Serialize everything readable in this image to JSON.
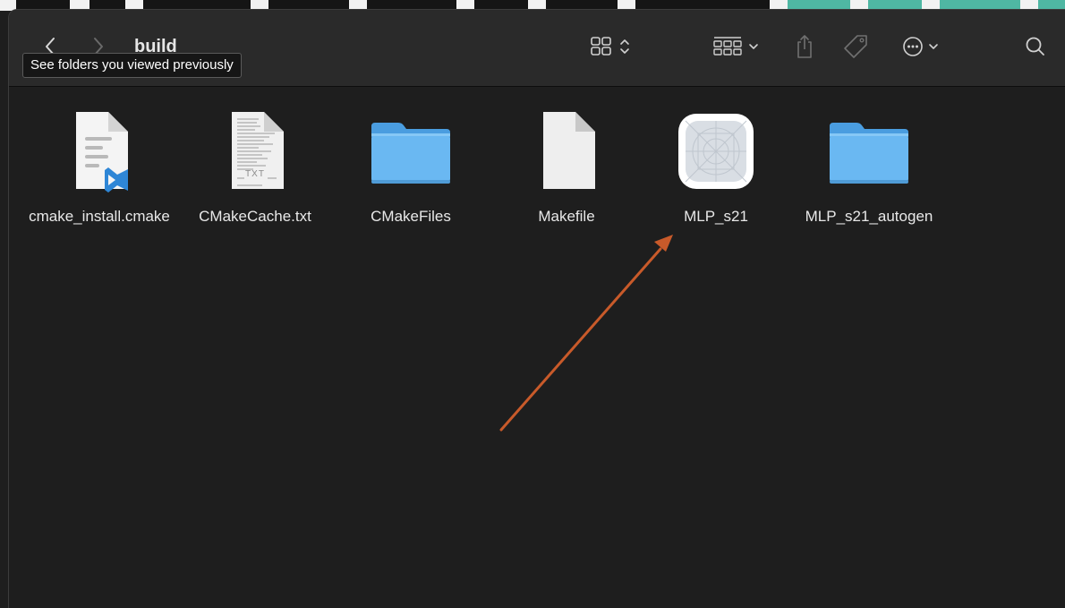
{
  "window": {
    "title": "build",
    "tooltip": "See folders you viewed previously"
  },
  "toolbar": {
    "back_icon": "chevron-left-icon",
    "forward_icon": "chevron-right-icon",
    "view_icon": "icon-grid-view-icon",
    "group_icon": "group-by-icon",
    "share_icon": "share-icon",
    "tag_icon": "tag-icon",
    "more_icon": "ellipsis-circle-icon",
    "search_icon": "search-icon"
  },
  "files": [
    {
      "name": "cmake_install.cmake",
      "kind": "vscode-document-icon"
    },
    {
      "name": "CMakeCache.txt",
      "kind": "text-document-icon",
      "icon_text": "TXT"
    },
    {
      "name": "CMakeFiles",
      "kind": "folder-icon"
    },
    {
      "name": "Makefile",
      "kind": "blank-document-icon"
    },
    {
      "name": "MLP_s21",
      "kind": "application-icon"
    },
    {
      "name": "MLP_s21_autogen",
      "kind": "folder-icon"
    }
  ],
  "colors": {
    "background": "#1e1e1e",
    "toolbar": "#2a2a2a",
    "folder_blue": "#5fb3ee",
    "vscode_blue": "#2e86d6",
    "annotation_arrow": "#c85a2a"
  }
}
